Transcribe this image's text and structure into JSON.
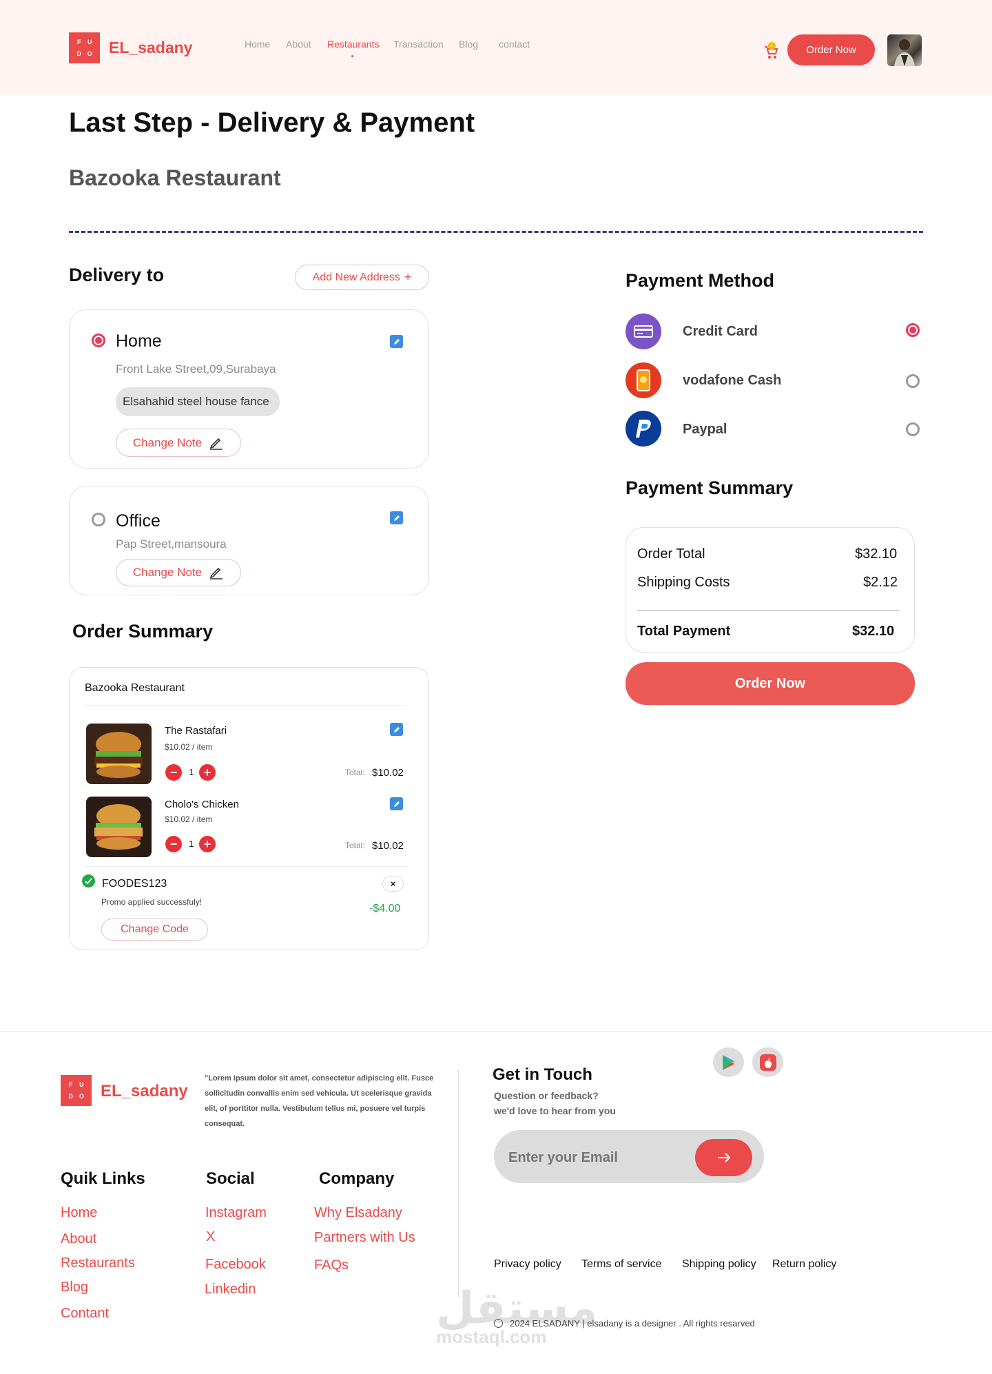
{
  "header": {
    "logo_letters": [
      "F",
      "U",
      "D",
      "O"
    ],
    "brand": "EL_sadany",
    "nav": [
      "Home",
      "About",
      "Restaurants",
      "Transaction",
      "Blog",
      "contact"
    ],
    "active_nav": "Restaurants",
    "cart_count": "1",
    "order_button": "Order Now"
  },
  "page": {
    "title": "Last Step - Delivery & Payment",
    "restaurant": "Bazooka Restaurant"
  },
  "delivery": {
    "heading": "Delivery to",
    "add_address": "Add New Address",
    "addresses": [
      {
        "name": "Home",
        "address": "Front Lake Street,09,Surabaya",
        "note": "Elsahahid steel house fance",
        "change_note": "Change Note",
        "selected": true
      },
      {
        "name": "Office",
        "address": "Pap Street,mansoura",
        "change_note": "Change Note",
        "selected": false
      }
    ]
  },
  "order_summary": {
    "heading": "Order Summary",
    "restaurant": "Bazooka Restaurant",
    "items": [
      {
        "name": "The Rastafari",
        "price": "$10.02 / item",
        "qty": "1",
        "total_label": "Total:",
        "total": "$10.02"
      },
      {
        "name": "Cholo's Chicken",
        "price": "$10.02 / item",
        "qty": "1",
        "total_label": "Total:",
        "total": "$10.02"
      }
    ],
    "promo": {
      "code": "FOODES123",
      "message": "Promo applied successfuly!",
      "discount": "-$4.00",
      "change": "Change Code"
    }
  },
  "payment": {
    "heading": "Payment Method",
    "methods": [
      {
        "name": "Credit Card",
        "selected": true
      },
      {
        "name": "vodafone Cash",
        "selected": false
      },
      {
        "name": "Paypal",
        "selected": false
      }
    ],
    "summary_heading": "Payment Summary",
    "rows": [
      {
        "label": "Order Total",
        "value": "$32.10"
      },
      {
        "label": "Shipping Costs",
        "value": "$2.12"
      }
    ],
    "total_label": "Total Payment",
    "total_value": "$32.10",
    "order_button": "Order Now"
  },
  "footer": {
    "brand": "EL_sadany",
    "about": "\"Lorem ipsum dolor sit amet, consectetur adipiscing elit. Fusce sollicitudin convallis enim sed vehicula. Ut scelerisque gravida elit, of porttitor nulla. Vestibulum tellus mi, posuere vel turpis consequat.",
    "quick_links": {
      "heading": "Quik Links",
      "items": [
        "Home",
        "About",
        "Restaurants",
        "Blog",
        "Contant"
      ]
    },
    "social": {
      "heading": "Social",
      "items": [
        "Instagram",
        "X",
        "Facebook",
        "Linkedin"
      ]
    },
    "company": {
      "heading": "Company",
      "items": [
        "Why Elsadany",
        "Partners with Us",
        "FAQs"
      ]
    },
    "contact": {
      "heading": "Get in Touch",
      "line1": "Question or feedback?",
      "line2": "we'd love to hear from you",
      "email_placeholder": "Enter your Email"
    },
    "policies": [
      "Privacy policy",
      "Terms of service",
      "Shipping policy",
      "Return policy"
    ],
    "copyright": "2024 ELSADANY | elsadany is a designer . All rights resarved",
    "watermark": "مستقل",
    "watermark_url": "mostaql.com"
  },
  "colors": {
    "accent": "#ea4a4a",
    "header_bg": "#fff4f1",
    "dash": "#2c3e7a",
    "success": "#22a845"
  }
}
